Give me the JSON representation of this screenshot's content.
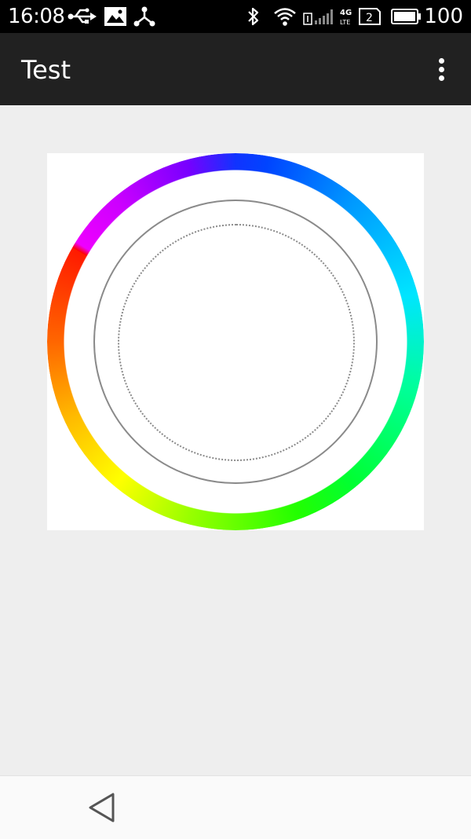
{
  "status_bar": {
    "time": "16:08",
    "battery_level": "100",
    "sim_slot": "2",
    "network_type": "4G LTE",
    "icons": [
      "usb-icon",
      "image-icon",
      "share-hub-icon",
      "bluetooth-icon",
      "wifi-icon",
      "signal-icon",
      "sim-icon",
      "battery-icon"
    ]
  },
  "app_bar": {
    "title": "Test",
    "menu_icon": "overflow-menu-icon"
  },
  "main": {
    "widget": "color-wheel-picker",
    "ring_hues": [
      "#1133ff",
      "#00e5ff",
      "#00ff33",
      "#ffff00",
      "#ff6600",
      "#ff0000",
      "#ee00ff",
      "#7700ff"
    ],
    "guide_color": "#8a8a8a",
    "background": "#ffffff"
  },
  "nav_bar": {
    "back_icon": "back-triangle-icon"
  },
  "colors": {
    "status_bar": "#000000",
    "app_bar": "#212121",
    "content_bg": "#eeeeee",
    "nav_bar": "#fafafa"
  }
}
